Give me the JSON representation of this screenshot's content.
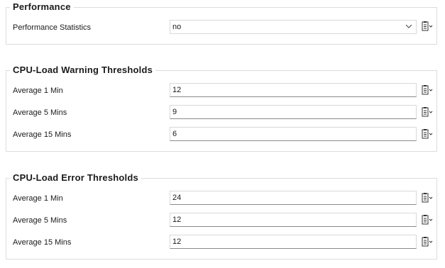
{
  "performance": {
    "title": "Performance",
    "statistics_label": "Performance Statistics",
    "statistics_value": "no"
  },
  "warning": {
    "title": "CPU-Load Warning Thresholds",
    "rows": [
      {
        "label": "Average 1 Min",
        "value": "12"
      },
      {
        "label": "Average 5 Mins",
        "value": "9"
      },
      {
        "label": "Average 15 Mins",
        "value": "6"
      }
    ]
  },
  "error": {
    "title": "CPU-Load Error Thresholds",
    "rows": [
      {
        "label": "Average 1 Min",
        "value": "24"
      },
      {
        "label": "Average 5 Mins",
        "value": "12"
      },
      {
        "label": "Average 15 Mins",
        "value": "12"
      }
    ]
  },
  "icons": {
    "field_action": "clipboard-icon",
    "dropdown": "chevron-down-icon"
  }
}
